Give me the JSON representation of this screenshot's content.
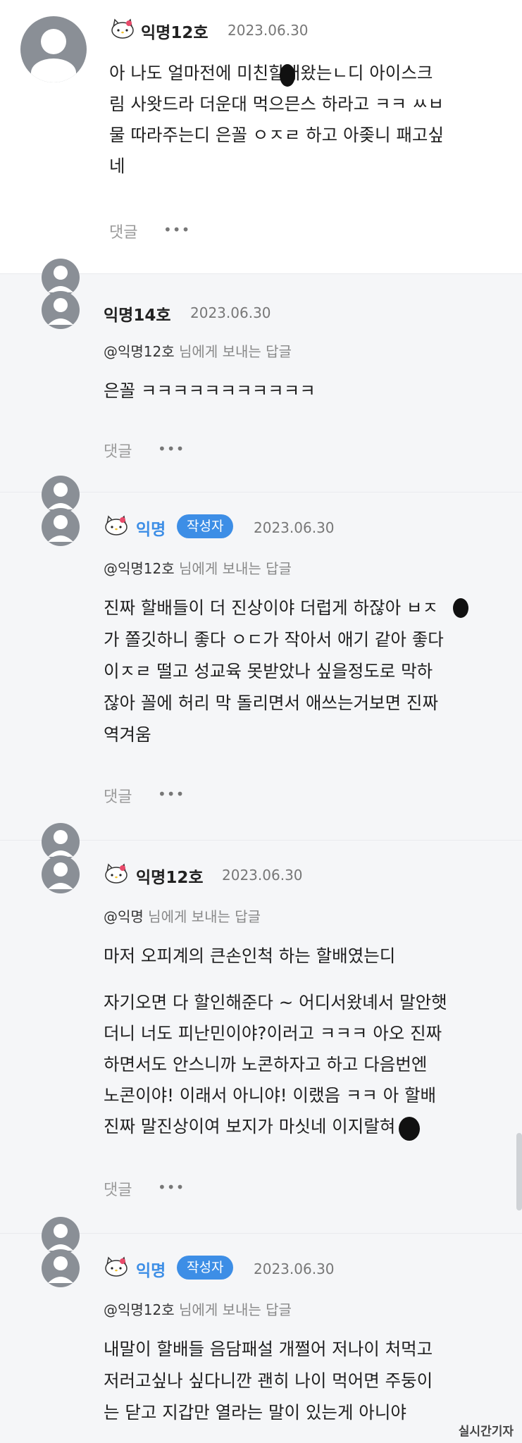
{
  "comments": [
    {
      "author": "익명12호",
      "date": "2023.06.30",
      "lines": [
        "아 나도 얼마전에 미친할배왔는ㄴ디 아이스크",
        "림 사왓드라 더운대 먹으믄스 하라고 ㅋㅋ ㅆㅂ",
        "물 따라주는디 은꼴 ㅇㅈㄹ 하고 아좆니 패고싶",
        "네"
      ],
      "reply_label": "댓글",
      "more": "•••"
    },
    {
      "author": "익명14호",
      "date": "2023.06.30",
      "mention": "@익명12호",
      "mention_suffix": "님에게 보내는 답글",
      "lines": [
        "은꼴 ㅋㅋㅋㅋㅋㅋㅋㅋㅋㅋㅋ"
      ],
      "reply_label": "댓글",
      "more": "•••"
    },
    {
      "author": "익명",
      "badge": "작성자",
      "date": "2023.06.30",
      "mention": "@익명12호",
      "mention_suffix": "님에게 보내는 답글",
      "lines": [
        "진짜 할배들이 더 진상이야 더럽게 하잖아 ㅂㅈ",
        "가 쫄깃하니 좋다 ㅇㄷ가 작아서 애기 같아 좋다",
        "이ㅈㄹ 떨고 성교육 못받았나 싶을정도로 막하",
        "잖아 꼴에 허리 막 돌리면서 애쓰는거보면 진짜",
        "역겨움"
      ],
      "reply_label": "댓글",
      "more": "•••"
    },
    {
      "author": "익명12호",
      "date": "2023.06.30",
      "mention": "@익명",
      "mention_suffix": "님에게 보내는 답글",
      "lines": [
        "마저 오피계의 큰손인척 하는 할배였는디",
        "",
        "자기오면 다 할인해준다 ~ 어디서왔녜서 말안햇",
        "더니 너도 피난민이야?이러고 ㅋㅋㅋ 아오 진짜",
        "하면서도 안스니까 노콘하자고 하고 다음번엔",
        "노콘이야! 이래서 아니야! 이랬음 ㅋㅋ 아 할배",
        "진짜 말진상이여 보지가 마싯네 이지랄혀"
      ],
      "reply_label": "댓글",
      "more": "•••"
    },
    {
      "author": "익명",
      "badge": "작성자",
      "date": "2023.06.30",
      "mention": "@익명12호",
      "mention_suffix": "님에게 보내는 답글",
      "lines": [
        "내말이 할배들 음담패설 개쩔어 저나이 처먹고",
        "저러고싶나 싶다니깐 괜히 나이 먹어면 주둥이",
        "는 닫고 지갑만 열라는 말이 있는게 아니야"
      ]
    }
  ],
  "watermark": "실시간기자"
}
